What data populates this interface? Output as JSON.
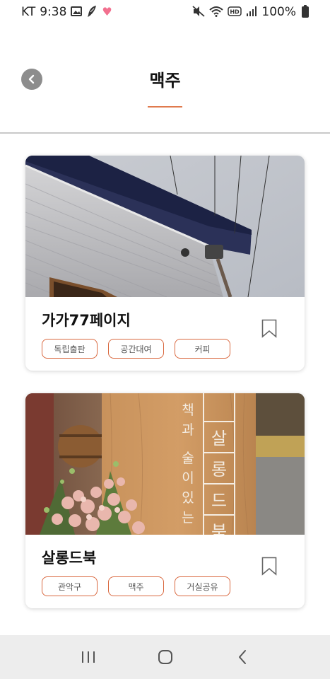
{
  "status_bar": {
    "carrier": "KT",
    "time": "9:38",
    "battery": "100%",
    "left_icons": [
      "image-icon",
      "feather-icon",
      "heart-icon"
    ],
    "right_icons": [
      "mute-icon",
      "wifi-icon",
      "hd-icon",
      "signal-icon",
      "battery-icon"
    ]
  },
  "header": {
    "title": "맥주",
    "back_icon": "chevron-left-icon"
  },
  "colors": {
    "accent": "#e07a4e",
    "tag_border": "#d9683f",
    "nav_background": "#ededed"
  },
  "places": [
    {
      "name": "가가77페이지",
      "tags": [
        "독립출판",
        "공간대여",
        "커피"
      ],
      "bookmark_icon": "bookmark-icon"
    },
    {
      "name": "살롱드북",
      "tags": [
        "관악구",
        "맥주",
        "거실공유"
      ],
      "bookmark_icon": "bookmark-icon",
      "image_text": {
        "vertical_left": [
          "책",
          "과",
          "술",
          "이",
          "있",
          "는"
        ],
        "vertical_right": [
          "살",
          "롱",
          "드",
          "북"
        ]
      }
    }
  ],
  "nav_bar": {
    "icons": [
      "recent-apps-icon",
      "home-icon",
      "back-icon"
    ]
  }
}
